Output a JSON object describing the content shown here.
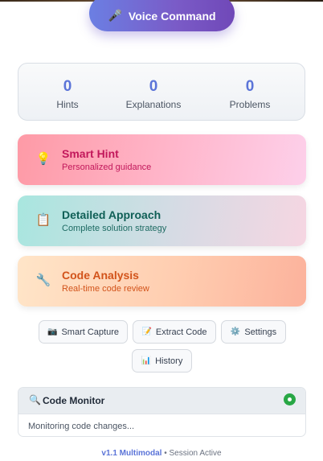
{
  "voice_command": {
    "label": "Voice Command",
    "icon": "microphone-icon",
    "glyph": "🎤"
  },
  "stats": [
    {
      "value": "0",
      "label": "Hints"
    },
    {
      "value": "0",
      "label": "Explanations"
    },
    {
      "value": "0",
      "label": "Problems"
    }
  ],
  "cards": [
    {
      "title": "Smart Hint",
      "subtitle": "Personalized guidance",
      "icon": "lightbulb-icon",
      "glyph": "💡"
    },
    {
      "title": "Detailed Approach",
      "subtitle": "Complete solution strategy",
      "icon": "clipboard-icon",
      "glyph": "📋"
    },
    {
      "title": "Code Analysis",
      "subtitle": "Real-time code review",
      "icon": "wrench-icon",
      "glyph": "🔧"
    }
  ],
  "actions": [
    {
      "label": "Smart Capture",
      "icon": "camera-icon",
      "glyph": "📷"
    },
    {
      "label": "Extract Code",
      "icon": "memo-icon",
      "glyph": "📝"
    },
    {
      "label": "Settings",
      "icon": "gear-icon",
      "glyph": "⚙️"
    },
    {
      "label": "History",
      "icon": "bar-chart-icon",
      "glyph": "📊"
    }
  ],
  "monitor": {
    "title": "Code Monitor",
    "icon": "magnifier-icon",
    "glyph": "🔍",
    "status_color": "#28a745",
    "message": "Monitoring code changes..."
  },
  "footer": {
    "version": "v1.1 Multimodal",
    "separator": "•",
    "session": "Session Active"
  },
  "colors": {
    "accent": "#5b74d8",
    "status_active": "#28a745"
  }
}
